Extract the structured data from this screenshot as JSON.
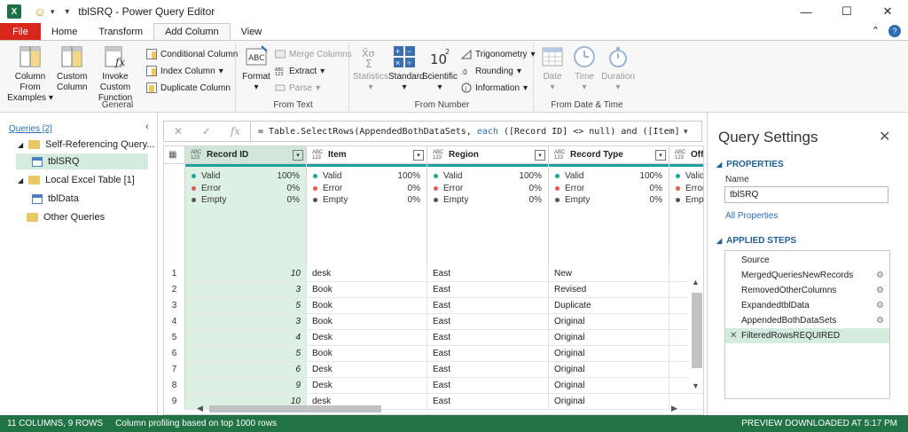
{
  "window": {
    "title": "tblSRQ - Power Query Editor",
    "app_icon": "X"
  },
  "tabs": [
    "File",
    "Home",
    "Transform",
    "Add Column",
    "View"
  ],
  "active_tab": "Add Column",
  "ribbon": {
    "general": {
      "label": "General",
      "col_from_examples": [
        "Column From",
        "Examples"
      ],
      "custom_column": [
        "Custom",
        "Column"
      ],
      "invoke_custom_function": [
        "Invoke Custom",
        "Function"
      ],
      "conditional_column": "Conditional Column",
      "index_column": "Index Column",
      "duplicate_column": "Duplicate Column"
    },
    "from_text": {
      "label": "From Text",
      "format": "Format",
      "merge_columns": "Merge Columns",
      "extract": "Extract",
      "parse": "Parse"
    },
    "from_number": {
      "label": "From Number",
      "statistics": "Statistics",
      "standard": "Standard",
      "scientific": "Scientific",
      "trigonometry": "Trigonometry",
      "rounding": "Rounding",
      "information": "Information"
    },
    "from_date_time": {
      "label": "From Date & Time",
      "date": "Date",
      "time": "Time",
      "duration": "Duration"
    }
  },
  "queries": {
    "header": "Queries [2]",
    "items": [
      {
        "label": "Self-Referencing Query...",
        "kind": "folder"
      },
      {
        "label": "tblSRQ",
        "kind": "table"
      },
      {
        "label": "Local Excel Table [1]",
        "kind": "folder"
      },
      {
        "label": "tblData",
        "kind": "table"
      },
      {
        "label": "Other Queries",
        "kind": "folder"
      }
    ]
  },
  "formula": {
    "prefix": "= Table.SelectRows(AppendedBothDataSets, ",
    "keyword": "each",
    "suffix": " ([Record ID] <> null) and ([Item] <>"
  },
  "columns": [
    {
      "name": "Record ID",
      "type": "ABC 123",
      "valid": "100%",
      "error": "0%",
      "empty": "0%"
    },
    {
      "name": "Item",
      "type": "ABC 123",
      "valid": "100%",
      "error": "0%",
      "empty": "0%"
    },
    {
      "name": "Region",
      "type": "ABC 123",
      "valid": "100%",
      "error": "0%",
      "empty": "0%"
    },
    {
      "name": "Record Type",
      "type": "ABC 123",
      "valid": "100%",
      "error": "0%",
      "empty": "0%"
    },
    {
      "name": "Offe",
      "type": "ABC 123",
      "valid": "Valid",
      "error": "Error",
      "empty": "Empt"
    }
  ],
  "profile_labels": {
    "valid": "Valid",
    "error": "Error",
    "empty": "Empty"
  },
  "rows": [
    [
      "1",
      "10",
      "desk",
      "East",
      "New"
    ],
    [
      "2",
      "3",
      "Book",
      "East",
      "Revised"
    ],
    [
      "3",
      "5",
      "Book",
      "East",
      "Duplicate"
    ],
    [
      "4",
      "3",
      "Book",
      "East",
      "Original"
    ],
    [
      "5",
      "4",
      "Desk",
      "East",
      "Original"
    ],
    [
      "6",
      "5",
      "Book",
      "East",
      "Original"
    ],
    [
      "7",
      "6",
      "Desk",
      "East",
      "Original"
    ],
    [
      "8",
      "9",
      "Desk",
      "East",
      "Original"
    ],
    [
      "9",
      "10",
      "desk",
      "East",
      "Original"
    ]
  ],
  "settings": {
    "title": "Query Settings",
    "properties": "PROPERTIES",
    "name_label": "Name",
    "name_value": "tblSRQ",
    "all_properties": "All Properties",
    "applied_steps": "APPLIED STEPS",
    "steps": [
      {
        "label": "Source",
        "gear": false
      },
      {
        "label": "MergedQueriesNewRecords",
        "gear": true
      },
      {
        "label": "RemovedOtherColumns",
        "gear": true
      },
      {
        "label": "ExpandedtblData",
        "gear": true
      },
      {
        "label": "AppendedBothDataSets",
        "gear": true
      },
      {
        "label": "FilteredRowsREQUIRED",
        "gear": false
      }
    ]
  },
  "status": {
    "counts": "11 COLUMNS, 9 ROWS",
    "profiling": "Column profiling based on top 1000 rows",
    "preview": "PREVIEW DOWNLOADED AT 5:17 PM"
  },
  "colors": {
    "accent": "#217346",
    "file_tab": "#d8261c",
    "profile_bar": "#1ea39c",
    "valid_dot": "#1ea39c",
    "error_dot": "#e05a4f",
    "empty_dot": "#555555"
  }
}
